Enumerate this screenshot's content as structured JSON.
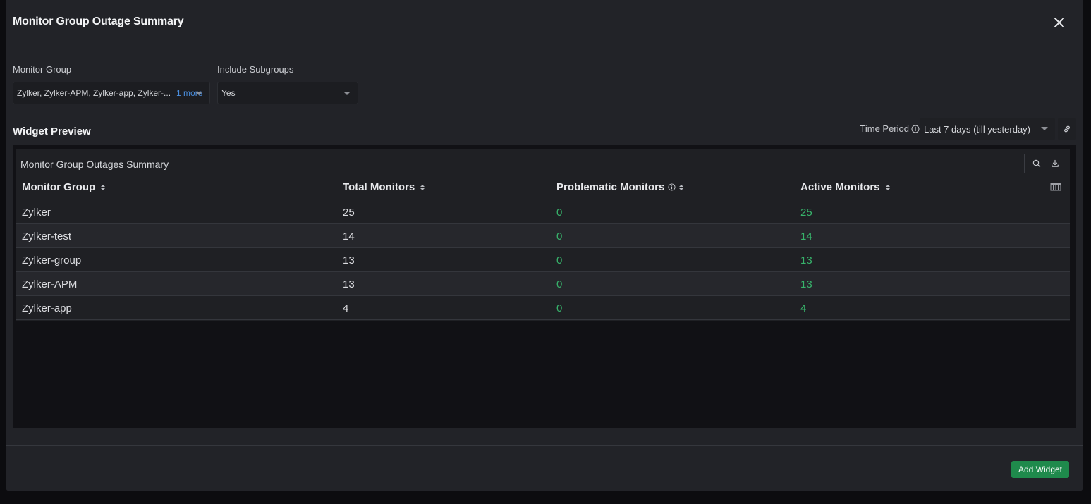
{
  "modal": {
    "title": "Monitor Group Outage Summary"
  },
  "filters": {
    "monitor_group_label": "Monitor Group",
    "monitor_group_value": "Zylker, Zylker-APM, Zylker-app, Zylker-...",
    "monitor_group_more": "1 more",
    "include_subgroups_label": "Include Subgroups",
    "include_subgroups_value": "Yes"
  },
  "preview": {
    "title": "Widget Preview",
    "time_period_label": "Time Period",
    "time_period_value": "Last 7 days (till yesterday)"
  },
  "widget": {
    "title": "Monitor Group Outages Summary",
    "columns": [
      "Monitor Group",
      "Total Monitors",
      "Problematic Monitors",
      "Active Monitors"
    ],
    "rows": [
      [
        "Zylker",
        "25",
        "0",
        "25"
      ],
      [
        "Zylker-test",
        "14",
        "0",
        "14"
      ],
      [
        "Zylker-group",
        "13",
        "0",
        "13"
      ],
      [
        "Zylker-APM",
        "13",
        "0",
        "13"
      ],
      [
        "Zylker-app",
        "4",
        "0",
        "4"
      ]
    ],
    "status_colors": {
      "positive": "#37b36b"
    }
  },
  "footer": {
    "add_widget_label": "Add Widget"
  },
  "icons": [
    "close-icon",
    "info-icon",
    "link-icon",
    "search-icon",
    "download-icon",
    "column-settings-icon",
    "sort-icon",
    "chevron-down-icon"
  ]
}
